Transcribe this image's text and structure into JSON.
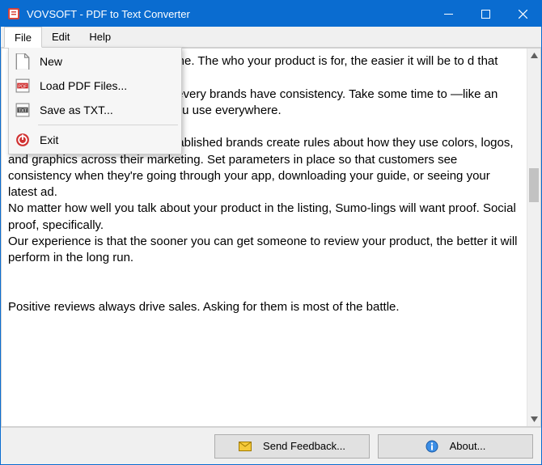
{
  "window": {
    "title": "VOVSOFT - PDF to Text Converter"
  },
  "menubar": {
    "items": [
      "File",
      "Edit",
      "Help"
    ]
  },
  "file_menu": {
    "new": "New",
    "load": "Load PDF Files...",
    "save": "Save as TXT...",
    "exit": "Exit"
  },
  "content": {
    "text": "ce. Your product isn't for everyone. The who your product is for, the easier it will be to d that connects with them.\nexplain your product differently every brands have consistency. Take some time to —like an elevator pitch or slogan—that you use everywhere.\n\nCreate rules for your brand. Established brands create rules about how they use colors, logos, and graphics across their marketing. Set parameters in place so that customers see consistency when they're going through your app, downloading your guide, or seeing your latest ad.\nNo matter how well you talk about your product in the listing, Sumo-lings will want proof. Social proof, specifically.\nOur experience is that the sooner you can get someone to review your product, the better it will perform in the long run.\n\n\nPositive reviews always drive sales. Asking for them is most of the battle."
  },
  "buttons": {
    "feedback": "Send Feedback...",
    "about": "About..."
  }
}
